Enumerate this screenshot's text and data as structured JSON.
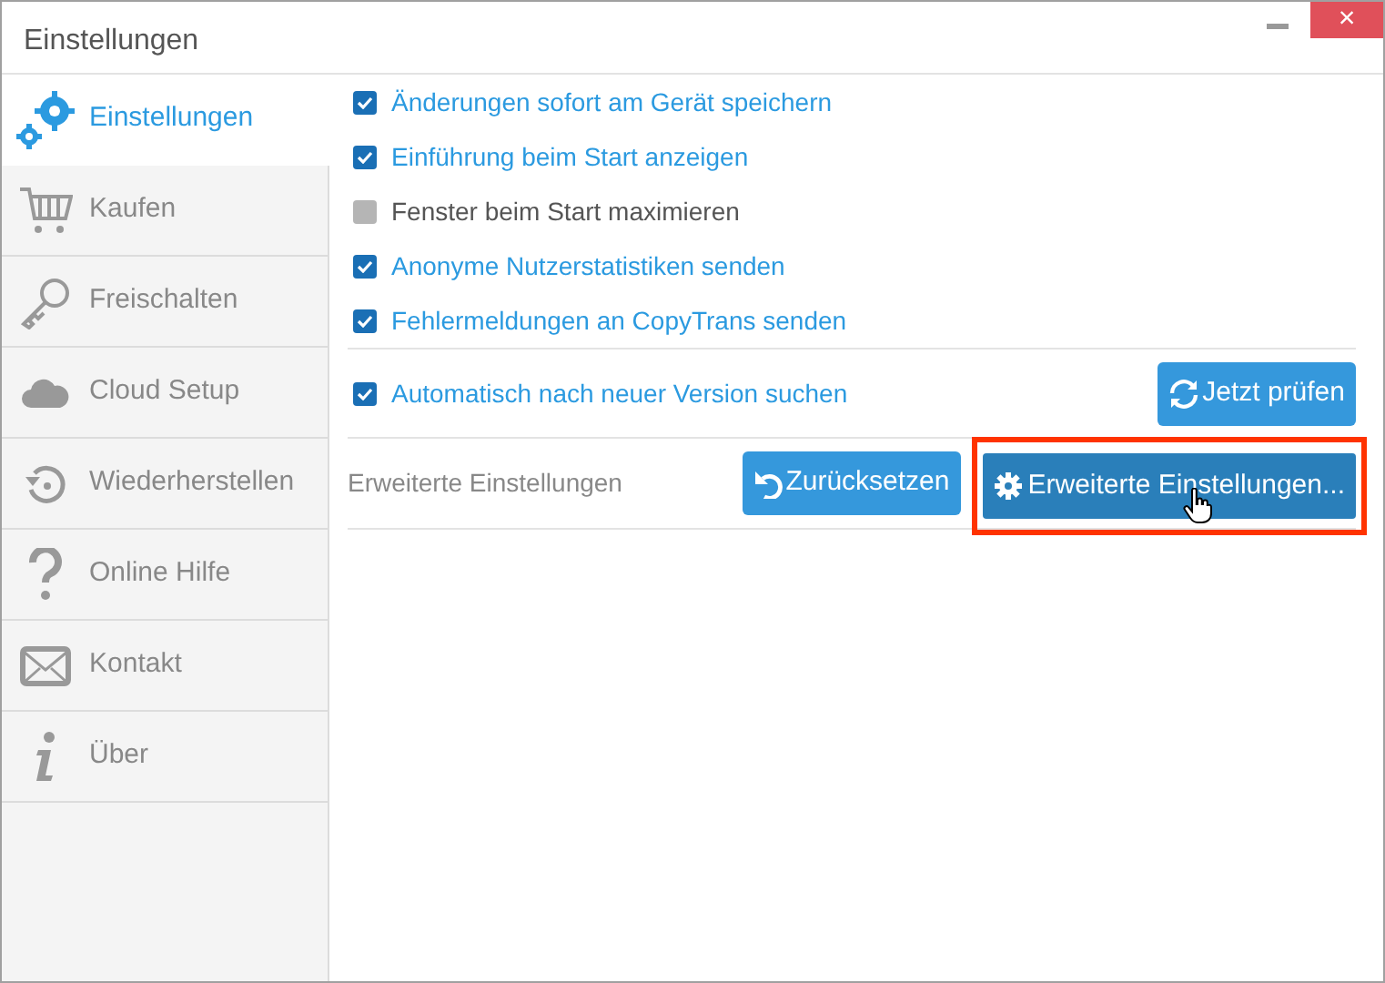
{
  "window": {
    "title": "Einstellungen",
    "close": "×"
  },
  "sidebar": {
    "items": [
      {
        "label": "Einstellungen",
        "selected": true
      },
      {
        "label": "Kaufen",
        "selected": false
      },
      {
        "label": "Freischalten",
        "selected": false
      },
      {
        "label": "Cloud Setup",
        "selected": false
      },
      {
        "label": "Wiederherstellen",
        "selected": false
      },
      {
        "label": "Online Hilfe",
        "selected": false
      },
      {
        "label": "Kontakt",
        "selected": false
      },
      {
        "label": "Über",
        "selected": false
      }
    ]
  },
  "options": [
    {
      "label": "Änderungen sofort am Gerät speichern",
      "checked": true
    },
    {
      "label": "Einführung beim Start anzeigen",
      "checked": true
    },
    {
      "label": "Fenster beim Start maximieren",
      "checked": false
    },
    {
      "label": "Anonyme Nutzerstatistiken senden",
      "checked": true
    },
    {
      "label": "Fehlermeldungen an CopyTrans senden",
      "checked": true
    }
  ],
  "update": {
    "label": "Automatisch nach neuer Version suchen",
    "checked": true,
    "button": "Jetzt prüfen"
  },
  "advanced": {
    "label": "Erweiterte Einstellungen",
    "reset_button": "Zurücksetzen",
    "advanced_button": {
      "label": "Erweiterte Einstellungen...",
      "highlighted": true
    }
  }
}
